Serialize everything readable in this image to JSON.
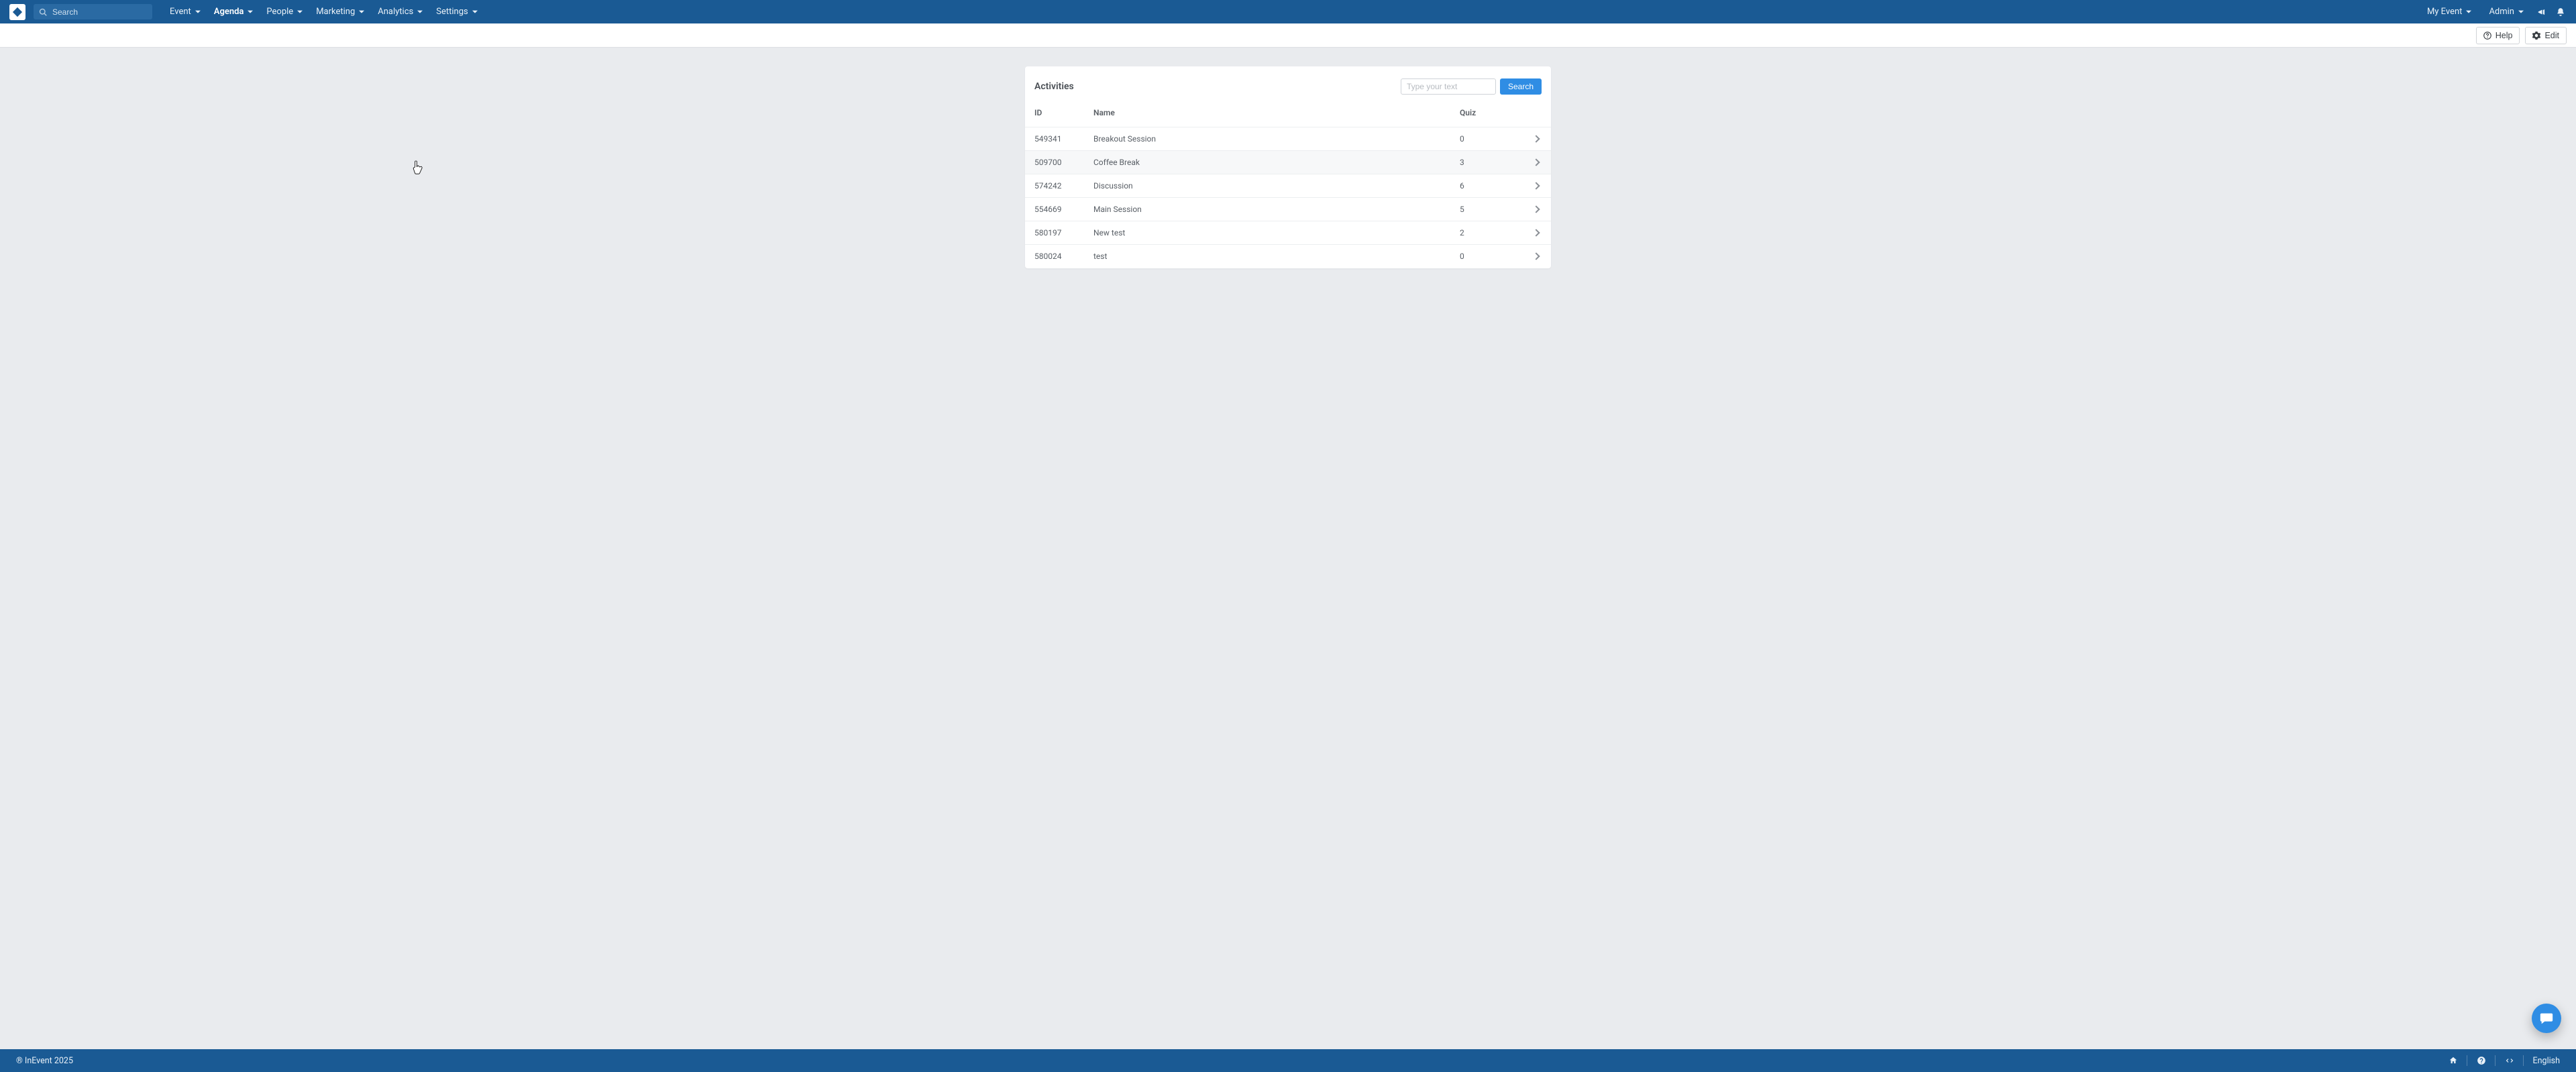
{
  "nav": {
    "search_placeholder": "Search",
    "items": [
      {
        "label": "Event",
        "active": false
      },
      {
        "label": "Agenda",
        "active": true
      },
      {
        "label": "People",
        "active": false
      },
      {
        "label": "Marketing",
        "active": false
      },
      {
        "label": "Analytics",
        "active": false
      },
      {
        "label": "Settings",
        "active": false
      }
    ],
    "right": {
      "my_event": "My Event",
      "admin": "Admin"
    }
  },
  "subbar": {
    "help": "Help",
    "edit": "Edit"
  },
  "card": {
    "title": "Activities",
    "search_placeholder": "Type your text",
    "search_button": "Search",
    "columns": {
      "id": "ID",
      "name": "Name",
      "quiz": "Quiz"
    },
    "rows": [
      {
        "id": "549341",
        "name": "Breakout Session",
        "quiz": "0"
      },
      {
        "id": "509700",
        "name": "Coffee Break",
        "quiz": "3"
      },
      {
        "id": "574242",
        "name": "Discussion",
        "quiz": "6"
      },
      {
        "id": "554669",
        "name": "Main Session",
        "quiz": "5"
      },
      {
        "id": "580197",
        "name": "New test",
        "quiz": "2"
      },
      {
        "id": "580024",
        "name": "test",
        "quiz": "0"
      }
    ]
  },
  "footer": {
    "copyright": "® InEvent 2025",
    "language": "English"
  }
}
